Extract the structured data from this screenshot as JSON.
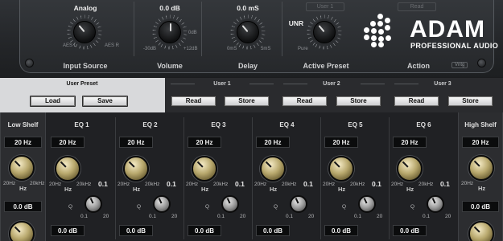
{
  "top": {
    "input_source": {
      "value": "Analog",
      "label": "Input Source",
      "left": "AES L",
      "right": "AES R"
    },
    "volume": {
      "value": "0.0 dB",
      "label": "Volume",
      "min": "-30dB",
      "mid": "0dB",
      "max": "+12dB"
    },
    "delay": {
      "value": "0.0 mS",
      "label": "Delay",
      "min": "0mS",
      "max": "5mS"
    },
    "active_preset": {
      "value": "UNR",
      "label": "Active Preset",
      "left": "Pure"
    },
    "action": {
      "label": "Action",
      "ghost_buttons": [
        "User 1",
        "Read"
      ],
      "badge": "Vntg"
    }
  },
  "brand": {
    "name": "ADAM",
    "subtitle": "PROFESSIONAL AUDIO"
  },
  "presets": {
    "user_preset": {
      "title": "User Preset",
      "load": "Load",
      "save": "Save"
    },
    "slots": [
      {
        "title": "User 1",
        "read": "Read",
        "store": "Store"
      },
      {
        "title": "User 2",
        "read": "Read",
        "store": "Store"
      },
      {
        "title": "User 3",
        "read": "Read",
        "store": "Store"
      }
    ]
  },
  "eq": {
    "low_shelf": {
      "title": "Low Shelf",
      "freq": "20 Hz",
      "gain": "0.0 dB",
      "min": "20Hz",
      "max": "20kHz",
      "unit": "Hz"
    },
    "high_shelf": {
      "title": "High Shelf",
      "freq": "20 Hz",
      "gain": "0.0 dB",
      "min": "20Hz",
      "unit": "Hz"
    },
    "bands": [
      {
        "title": "EQ 1",
        "freq": "20 Hz",
        "q": "0.1",
        "gain": "0.0 dB",
        "min": "20Hz",
        "max": "20kHz",
        "unit": "Hz",
        "q_label": "Q",
        "q_min": "0.1",
        "q_max": "20"
      },
      {
        "title": "EQ 2",
        "freq": "20 Hz",
        "q": "0.1",
        "gain": "0.0 dB",
        "min": "20Hz",
        "max": "20kHz",
        "unit": "Hz",
        "q_label": "Q",
        "q_min": "0.1",
        "q_max": "20"
      },
      {
        "title": "EQ 3",
        "freq": "20 Hz",
        "q": "0.1",
        "gain": "0.0 dB",
        "min": "20Hz",
        "max": "20kHz",
        "unit": "Hz",
        "q_label": "Q",
        "q_min": "0.1",
        "q_max": "20"
      },
      {
        "title": "EQ 4",
        "freq": "20 Hz",
        "q": "0.1",
        "gain": "0.0 dB",
        "min": "20Hz",
        "max": "20kHz",
        "unit": "Hz",
        "q_label": "Q",
        "q_min": "0.1",
        "q_max": "20"
      },
      {
        "title": "EQ 5",
        "freq": "20 Hz",
        "q": "0.1",
        "gain": "0.0 dB",
        "min": "20Hz",
        "max": "20kHz",
        "unit": "Hz",
        "q_label": "Q",
        "q_min": "0.1",
        "q_max": "20"
      },
      {
        "title": "EQ 6",
        "freq": "20 Hz",
        "q": "0.1",
        "gain": "0.0 dB",
        "min": "20Hz",
        "max": "20kHz",
        "unit": "Hz",
        "q_label": "Q",
        "q_min": "0.1",
        "q_max": "20"
      }
    ]
  }
}
